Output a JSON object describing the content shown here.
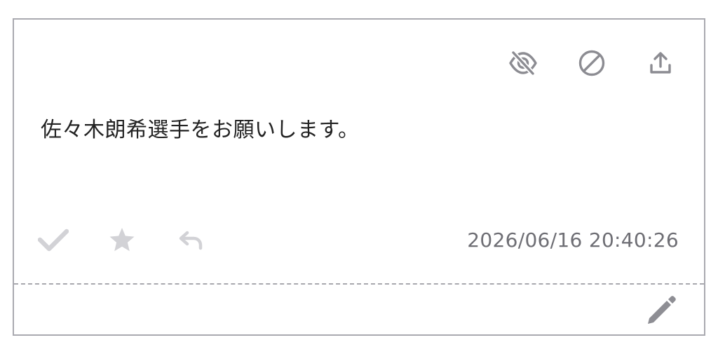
{
  "post": {
    "message": "佐々木朗希選手をお願いします。",
    "timestamp": "2026/06/16 20:40:26"
  },
  "icons": {
    "top": [
      "eye-off-icon",
      "block-icon",
      "upload-icon"
    ],
    "bottom": [
      "check-icon",
      "star-icon",
      "reply-icon"
    ],
    "footer": [
      "pencil-icon"
    ]
  },
  "colors": {
    "top_icon": "#8c8c92",
    "bottom_icon": "#d2d2d6",
    "edit_icon": "#8e8e94",
    "border": "#a9a9b0",
    "timestamp": "#6e6e74"
  }
}
